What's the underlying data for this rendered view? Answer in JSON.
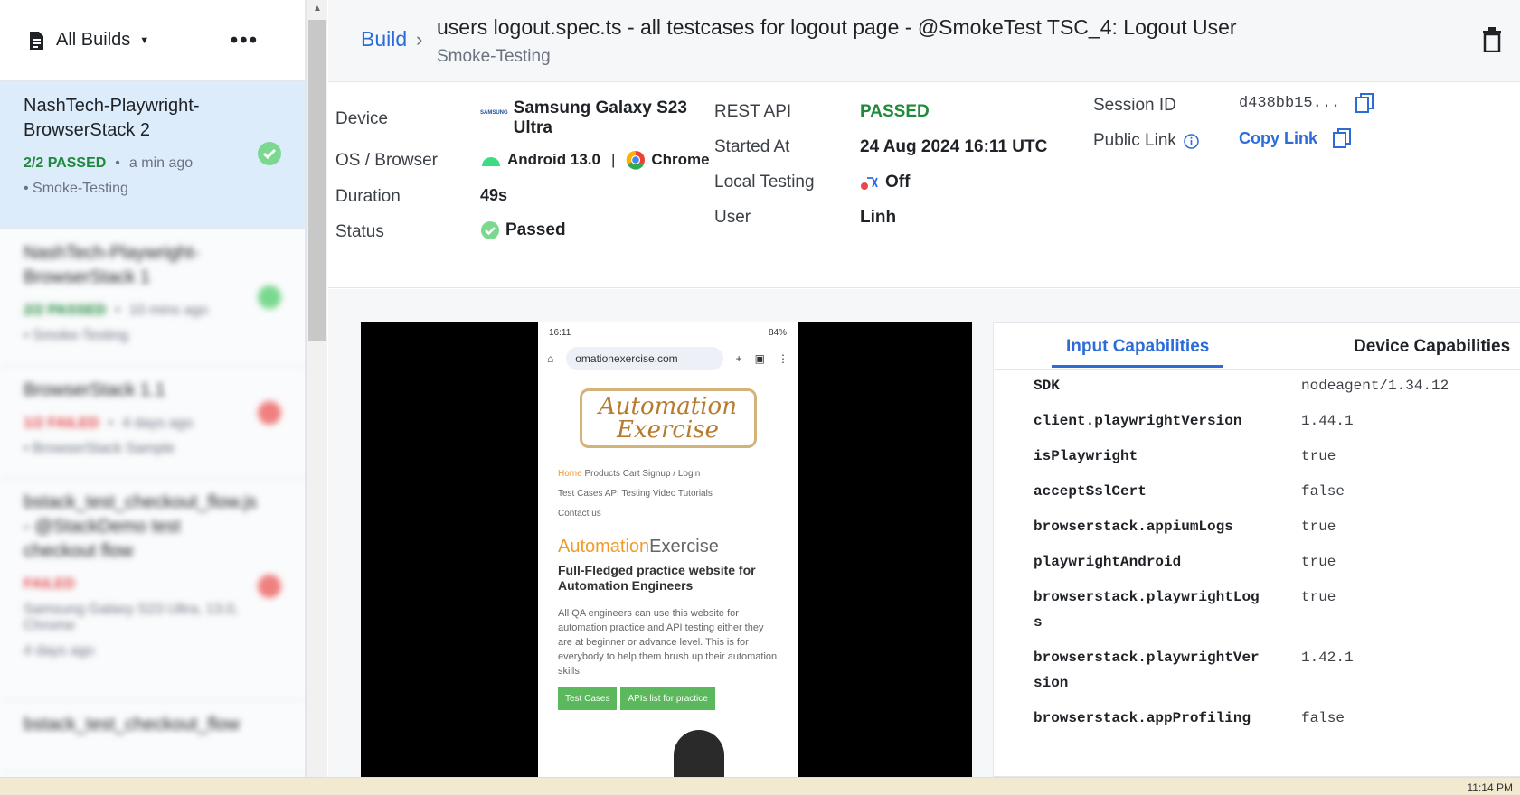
{
  "sidebar": {
    "title": "All Builds",
    "items": [
      {
        "name": "NashTech-Playwright-BrowserStack 2",
        "status_text": "2/2 PASSED",
        "time": "a min ago",
        "tag": "Smoke-Testing"
      },
      {
        "name": "NashTech-Playwright-BrowserStack 1",
        "status_text": "2/2 PASSED",
        "time": "10 mins ago",
        "tag": "Smoke-Testing"
      },
      {
        "name": "BrowserStack 1.1",
        "status_text": "1/2 FAILED",
        "time": "4 days ago",
        "tag": "BrowserStack Sample"
      },
      {
        "name": "bstack_test_checkout_flow.js - @StackDemo test checkout flow",
        "status_text": "FAILED",
        "time": "Samsung Galaxy S23 Ultra, 13.0, Chrome",
        "tag": "4 days ago"
      },
      {
        "name": "bstack_test_checkout_flow",
        "status_text": "",
        "time": "",
        "tag": ""
      }
    ]
  },
  "header": {
    "breadcrumb": "Build",
    "title": "users logout.spec.ts - all testcases for logout page - @SmokeTest TSC_4: Logout User",
    "subtitle": "Smoke-Testing"
  },
  "info": {
    "device_label": "Device",
    "device_value": "Samsung Galaxy S23 Ultra",
    "os_label": "OS / Browser",
    "os_value": "Android 13.0",
    "browser_value": "Chrome",
    "duration_label": "Duration",
    "duration_value": "49s",
    "status_label": "Status",
    "status_value": "Passed",
    "rest_label": "REST API",
    "rest_value": "PASSED",
    "started_label": "Started At",
    "started_value": "24 Aug 2024 16:11 UTC",
    "local_label": "Local Testing",
    "local_value": "Off",
    "user_label": "User",
    "user_value": "Linh",
    "session_label": "Session ID",
    "session_value": "d438bb15...",
    "public_label": "Public Link",
    "copy_link": "Copy Link"
  },
  "phone": {
    "time": "16:11",
    "battery": "84%",
    "url": "omationexercise.com",
    "logo_line1": "Automation",
    "logo_line2": "Exercise",
    "nav_home": "Home",
    "nav_items": "Products  Cart  Signup / Login",
    "nav_items2": "Test Cases  API Testing  Video Tutorials",
    "nav_contact": "Contact us",
    "brand_a": "Automation",
    "brand_b": "Exercise",
    "tagline": "Full-Fledged practice website for Automation Engineers",
    "description": "All QA engineers can use this website for automation practice and API testing either they are at beginner or advance level. This is for everybody to help them brush up their automation skills.",
    "btn_test_cases": "Test Cases",
    "btn_apis": "APIs list for practice"
  },
  "capabilities": {
    "tab_input": "Input Capabilities",
    "tab_device": "Device Capabilities",
    "rows": [
      {
        "key": "SDK",
        "value": "nodeagent/1.34.12"
      },
      {
        "key": "client.playwrightVersion",
        "value": "1.44.1"
      },
      {
        "key": "isPlaywright",
        "value": "true"
      },
      {
        "key": "acceptSslCert",
        "value": "false"
      },
      {
        "key": "browserstack.appiumLogs",
        "value": "true"
      },
      {
        "key": "playwrightAndroid",
        "value": "true"
      },
      {
        "key": "browserstack.playwrightLogs",
        "value": "true"
      },
      {
        "key": "browserstack.playwrightVersion",
        "value": "1.42.1"
      },
      {
        "key": "browserstack.appProfiling",
        "value": "false"
      }
    ]
  },
  "taskbar": {
    "clock": "11:14 PM"
  },
  "colors": {
    "accent": "#2b6cd8",
    "pass": "#1f8a3b",
    "fail": "#e5484d",
    "active_bg": "#dcecfb"
  }
}
